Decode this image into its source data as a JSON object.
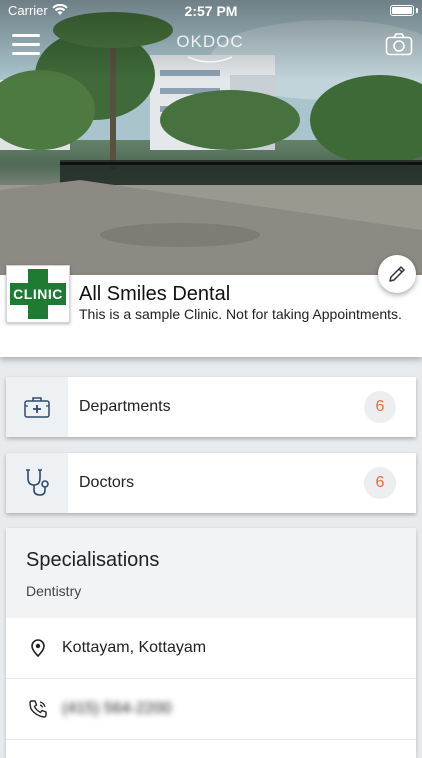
{
  "status_bar": {
    "carrier": "Carrier",
    "time": "2:57 PM"
  },
  "header": {
    "logo_text": "OKDOC"
  },
  "clinic": {
    "logo_text": "CLINIC",
    "name": "All Smiles Dental",
    "description": "This is a sample Clinic. Not for taking Appointments."
  },
  "lists": [
    {
      "label": "Departments",
      "count": "6",
      "icon": "medical-kit-icon"
    },
    {
      "label": "Doctors",
      "count": "6",
      "icon": "stethoscope-icon"
    }
  ],
  "specialisations": {
    "title": "Specialisations",
    "items": [
      "Dentistry"
    ]
  },
  "info": {
    "location": "Kottayam, Kottayam",
    "phone": "(415) 564-2200"
  },
  "colors": {
    "accent": "#f06b3d",
    "clinic_green": "#1f7a34",
    "icon_blue": "#2e4a6b"
  }
}
